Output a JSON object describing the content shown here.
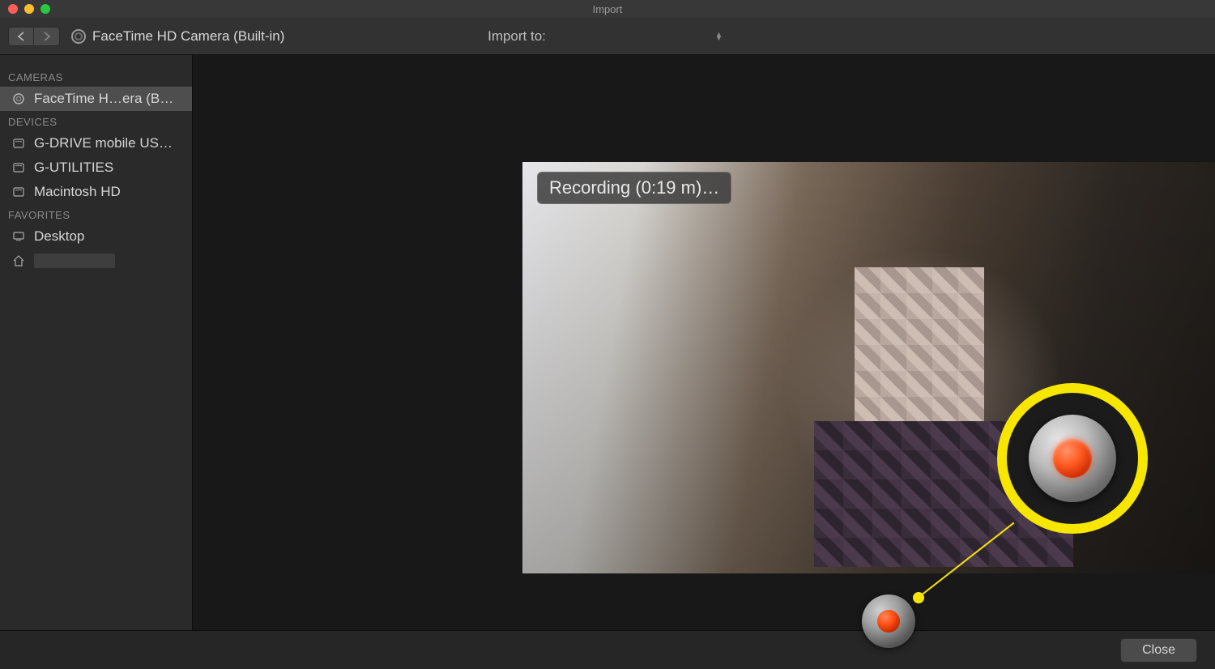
{
  "window": {
    "title": "Import"
  },
  "toolbar": {
    "camera_label": "FaceTime HD Camera (Built-in)",
    "import_to_label": "Import to:"
  },
  "sidebar": {
    "sections": [
      {
        "head": "CAMERAS",
        "items": [
          {
            "label": "FaceTime H…era (Built-in)",
            "icon": "camera",
            "selected": true
          }
        ]
      },
      {
        "head": "DEVICES",
        "items": [
          {
            "label": "G-DRIVE mobile USB-C",
            "icon": "drive",
            "selected": false
          },
          {
            "label": "G-UTILITIES",
            "icon": "drive",
            "selected": false
          },
          {
            "label": "Macintosh HD",
            "icon": "drive",
            "selected": false
          }
        ]
      },
      {
        "head": "FAVORITES",
        "items": [
          {
            "label": "Desktop",
            "icon": "desktop",
            "selected": false
          },
          {
            "label": "",
            "icon": "home",
            "selected": false,
            "redact": true
          }
        ]
      }
    ]
  },
  "preview": {
    "recording_label": "Recording (0:19 m)…"
  },
  "footer": {
    "close_label": "Close"
  },
  "annotation": {
    "color": "#f7e600"
  }
}
